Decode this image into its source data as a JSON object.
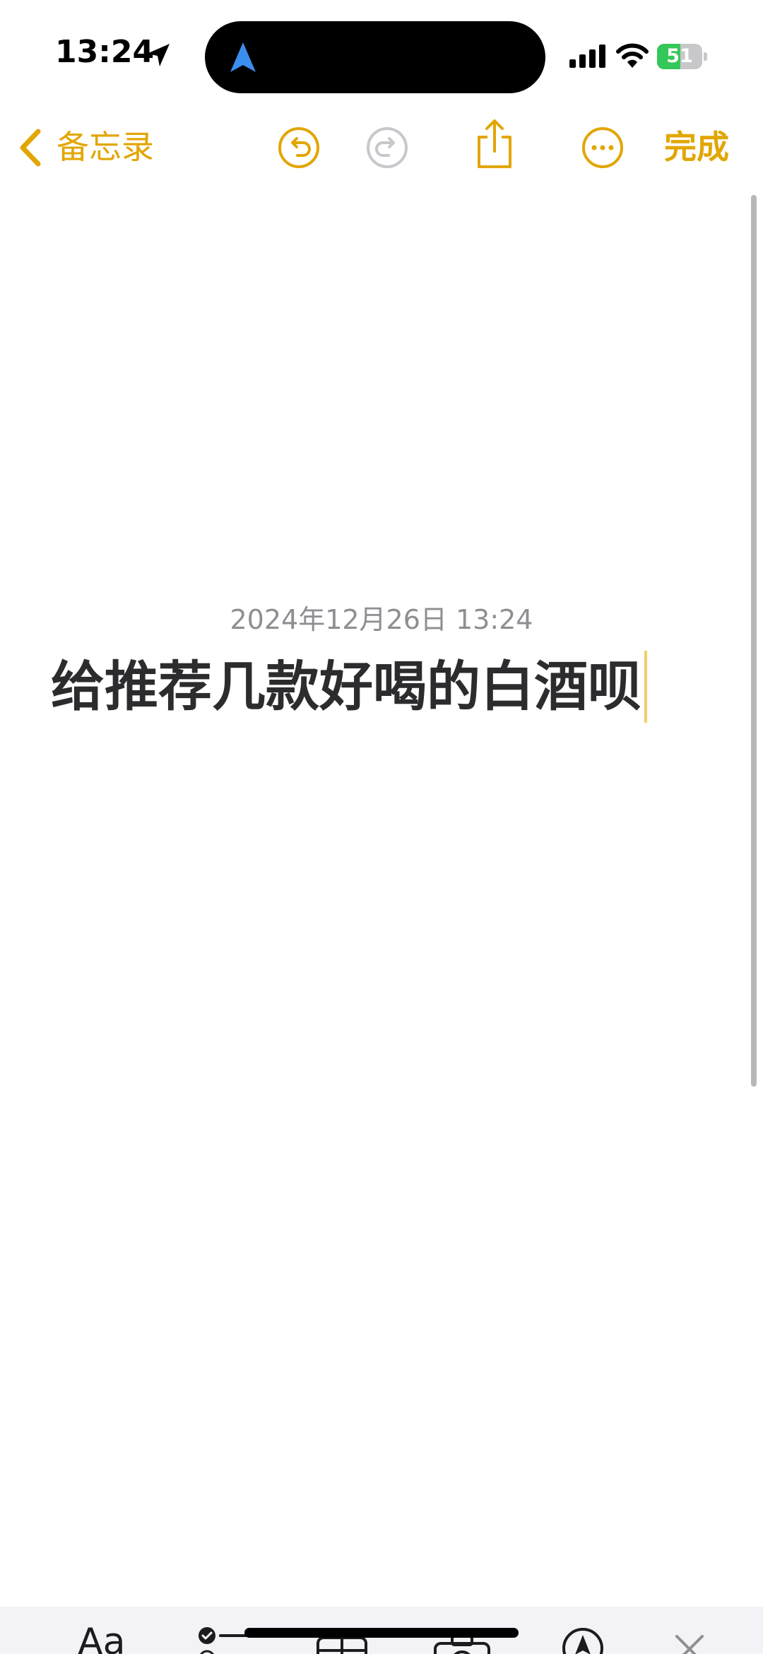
{
  "status_bar": {
    "time": "13:24",
    "battery_level": "51",
    "battery_fraction": 0.51,
    "icons": [
      "location-arrow-icon",
      "navigation-icon",
      "cellular-signal-icon",
      "wifi-icon",
      "battery-charging-icon"
    ]
  },
  "nav": {
    "back_label": "备忘录",
    "done_label": "完成",
    "icons": [
      "chevron-left-icon",
      "undo-icon",
      "redo-icon",
      "share-icon",
      "more-icon"
    ],
    "redo_enabled": false
  },
  "note": {
    "date": "2024年12月26日 13:24",
    "title": "给推荐几款好喝的白酒呗"
  },
  "toolbar": {
    "format_label": "Aa",
    "icons": [
      "checklist-icon",
      "table-icon",
      "camera-icon",
      "markup-icon",
      "close-icon"
    ]
  },
  "colors": {
    "accent": "#e2a603",
    "disabled": "#c7c7cc",
    "text": "#2c2c2e",
    "secondary_text": "#8e8e93",
    "battery_green": "#34c759"
  }
}
